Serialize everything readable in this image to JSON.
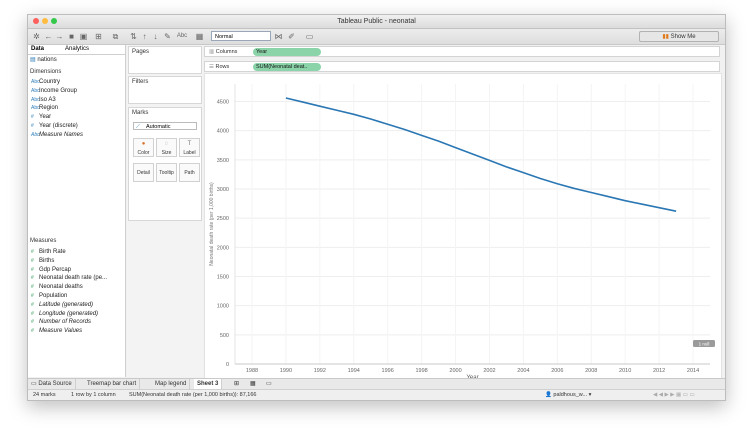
{
  "window": {
    "title": "Tableau Public - neonatal"
  },
  "toolbar": {
    "mark_size_select": "Normal",
    "show_me_label": "Show Me",
    "abc_label": "Abc"
  },
  "data_pane": {
    "tabs": [
      "Data",
      "Analytics"
    ],
    "source": "nations",
    "dimensions_title": "Dimensions",
    "dimensions": [
      {
        "label": "Country",
        "italic": false
      },
      {
        "label": "Income Group",
        "italic": false
      },
      {
        "label": "Iso A3",
        "italic": false
      },
      {
        "label": "Region",
        "italic": false
      },
      {
        "label": "Year",
        "italic": false
      },
      {
        "label": "Year (discrete)",
        "italic": false
      },
      {
        "label": "Measure Names",
        "italic": true
      }
    ],
    "measures_title": "Measures",
    "measures": [
      {
        "label": "Birth Rate",
        "italic": false
      },
      {
        "label": "Births",
        "italic": false
      },
      {
        "label": "Gdp Percap",
        "italic": false
      },
      {
        "label": "Neonatal death rate (pe...",
        "italic": false
      },
      {
        "label": "Neonatal deaths",
        "italic": false
      },
      {
        "label": "Population",
        "italic": false
      },
      {
        "label": "Latitude (generated)",
        "italic": true
      },
      {
        "label": "Longitude (generated)",
        "italic": true
      },
      {
        "label": "Number of Records",
        "italic": true
      },
      {
        "label": "Measure Values",
        "italic": true
      }
    ]
  },
  "cards": {
    "pages": "Pages",
    "filters": "Filters",
    "marks": "Marks",
    "mark_type": "Automatic",
    "mark_buttons": [
      "Color",
      "Size",
      "Label",
      "Detail",
      "Tooltip",
      "Path"
    ]
  },
  "shelves": {
    "columns_label": "Columns",
    "columns_pill": "Year",
    "rows_label": "Rows",
    "rows_pill": "SUM(Neonatal deat.."
  },
  "chart_data": {
    "type": "line",
    "title": "",
    "xlabel": "Year",
    "ylabel": "Neonatal death rate (per 1,000 births)",
    "xlim": [
      1987,
      2015
    ],
    "ylim": [
      0,
      4800
    ],
    "xticks": [
      1988,
      1990,
      1992,
      1994,
      1996,
      1998,
      2000,
      2002,
      2004,
      2006,
      2008,
      2010,
      2012,
      2014
    ],
    "yticks": [
      0,
      500,
      1000,
      1500,
      2000,
      2500,
      3000,
      3500,
      4000,
      4500
    ],
    "series": [
      {
        "color": "#2a77b4",
        "x": [
          1990,
          1991,
          1992,
          1993,
          1994,
          1995,
          1996,
          1997,
          1998,
          1999,
          2000,
          2001,
          2002,
          2003,
          2004,
          2005,
          2006,
          2007,
          2008,
          2009,
          2010,
          2011,
          2012,
          2013
        ],
        "values": [
          4560,
          4490,
          4420,
          4350,
          4280,
          4200,
          4110,
          4020,
          3920,
          3820,
          3710,
          3600,
          3490,
          3380,
          3280,
          3180,
          3090,
          3010,
          2940,
          2870,
          2800,
          2740,
          2680,
          2620
        ]
      }
    ],
    "grid": true,
    "null_badge": "1 null"
  },
  "sheet_tabs": [
    "Data Source",
    "Treemap bar chart",
    "Map legend",
    "Sheet 3"
  ],
  "active_sheet": "Sheet 3",
  "status": {
    "marks": "24 marks",
    "layout": "1 row by 1 column",
    "sum": "SUM(Neonatal death rate (per 1,000 births)): 87,166",
    "user": "paldhous_w..."
  }
}
